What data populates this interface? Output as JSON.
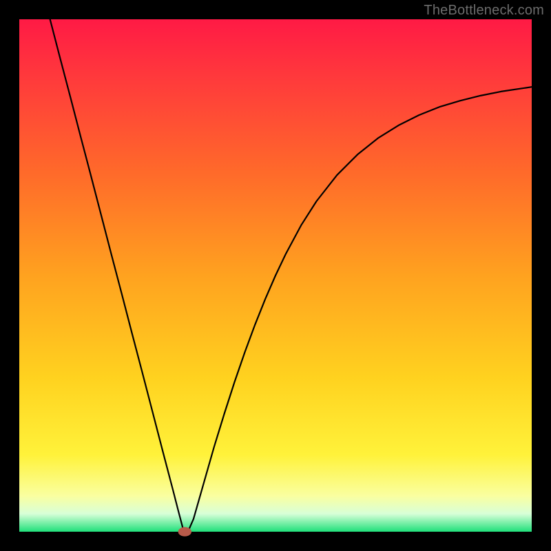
{
  "attribution": "TheBottleneck.com",
  "chart_data": {
    "type": "line",
    "title": "",
    "xlabel": "",
    "ylabel": "",
    "xlim": [
      0,
      100
    ],
    "ylim": [
      0,
      100
    ],
    "gradient": {
      "stops": [
        {
          "offset": 0.0,
          "color": "#ff1a45"
        },
        {
          "offset": 0.12,
          "color": "#ff3b3b"
        },
        {
          "offset": 0.3,
          "color": "#ff6a2a"
        },
        {
          "offset": 0.5,
          "color": "#ffa21f"
        },
        {
          "offset": 0.7,
          "color": "#ffd21f"
        },
        {
          "offset": 0.85,
          "color": "#fff23a"
        },
        {
          "offset": 0.93,
          "color": "#faffa0"
        },
        {
          "offset": 0.965,
          "color": "#d8ffd8"
        },
        {
          "offset": 1.0,
          "color": "#1fe07a"
        }
      ]
    },
    "series": [
      {
        "name": "bottleneck-curve",
        "x": [
          6,
          8,
          10,
          12,
          14,
          16,
          18,
          20,
          22,
          24,
          26,
          28,
          30,
          31,
          32,
          33,
          34,
          36,
          38,
          40,
          42,
          44,
          46,
          48,
          50,
          52,
          55,
          58,
          62,
          66,
          70,
          74,
          78,
          82,
          86,
          90,
          94,
          98,
          100
        ],
        "y": [
          100,
          92.3,
          84.7,
          77.0,
          69.4,
          61.7,
          54.0,
          46.4,
          38.7,
          31.1,
          23.4,
          15.7,
          8.1,
          4.2,
          0.4,
          0.2,
          2.5,
          9.5,
          16.5,
          23.0,
          29.2,
          35.0,
          40.4,
          45.4,
          50.0,
          54.2,
          59.8,
          64.5,
          69.6,
          73.6,
          76.8,
          79.3,
          81.3,
          82.9,
          84.1,
          85.1,
          85.9,
          86.5,
          86.8
        ]
      }
    ],
    "annotations": [
      {
        "name": "minimum-marker",
        "x": 32.3,
        "y": 0.0,
        "rx": 1.3,
        "ry": 0.9
      }
    ]
  }
}
